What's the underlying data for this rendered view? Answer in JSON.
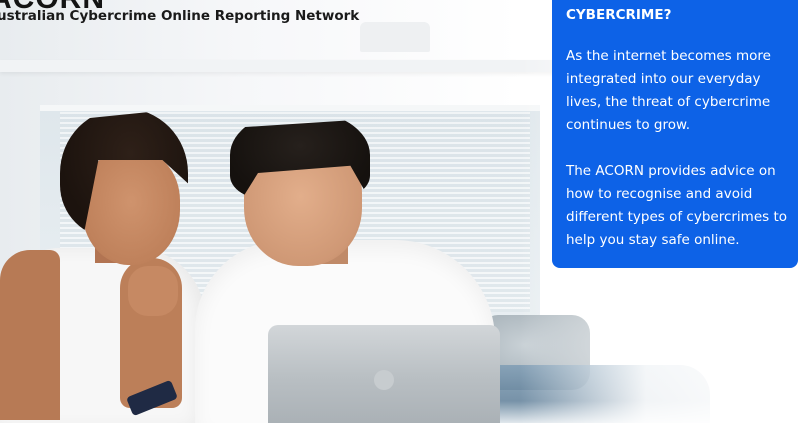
{
  "header": {
    "brand": "ACORN",
    "subtitle": "ustralian Cybercrime Online Reporting Network"
  },
  "info_panel": {
    "heading": "CYBERCRIME?",
    "paragraphs": [
      "As the internet becomes more integrated into our everyday lives, the threat of cybercrime continues to grow.",
      "The ACORN provides advice on how to recognise and avoid different types of cybercrimes to help you stay safe online."
    ],
    "background_color": "#0d62e7"
  },
  "hero_image": {
    "icon": "photo-couple-using-laptop"
  }
}
